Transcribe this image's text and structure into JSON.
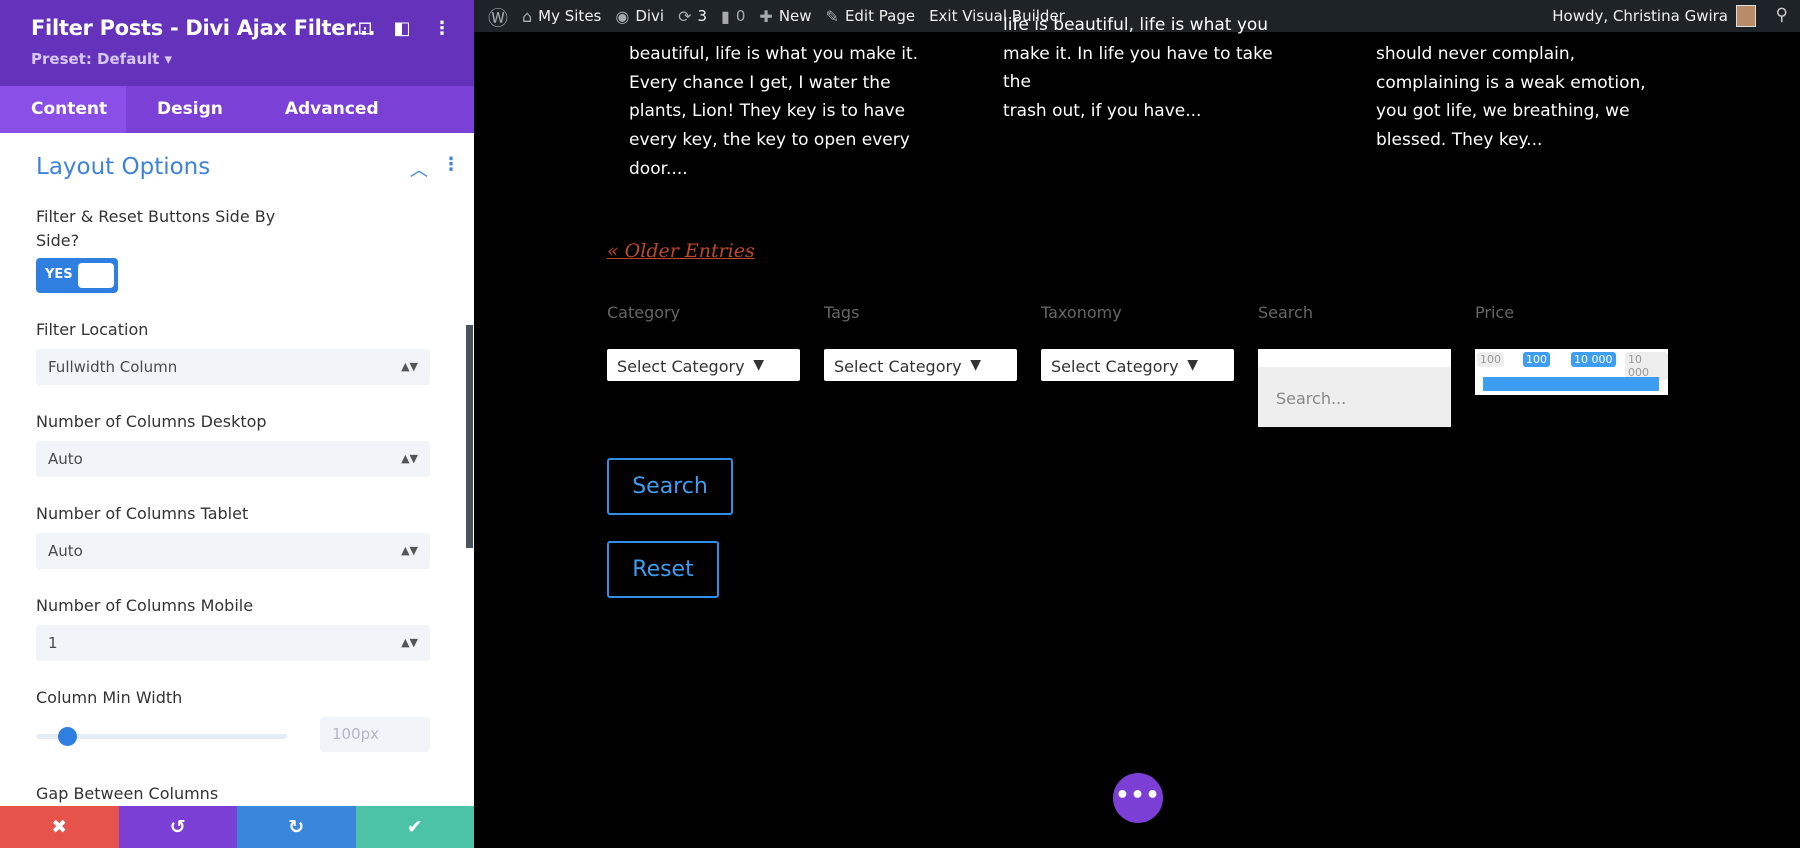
{
  "panel": {
    "title": "Filter Posts - Divi Ajax Filter...",
    "preset": "Preset: Default ▾",
    "tabs": [
      "Content",
      "Design",
      "Advanced"
    ],
    "section_title": "Layout Options",
    "fields": {
      "side_by_side_label": "Filter & Reset Buttons Side By Side?",
      "side_by_side_value": "YES",
      "filter_location_label": "Filter Location",
      "filter_location_value": "Fullwidth Column",
      "cols_desktop_label": "Number of Columns Desktop",
      "cols_desktop_value": "Auto",
      "cols_tablet_label": "Number of Columns Tablet",
      "cols_tablet_value": "Auto",
      "cols_mobile_label": "Number of Columns Mobile",
      "cols_mobile_value": "1",
      "min_width_label": "Column Min Width",
      "min_width_value": "100px",
      "gap_label": "Gap Between Columns"
    },
    "bottom": {
      "cancel": "✖",
      "undo": "↺",
      "redo": "↻",
      "save": "✔"
    },
    "colors": {
      "header": "#6532bb",
      "tabs": "#7b40d6",
      "accent": "#3e83d9",
      "cancel": "#e5534b",
      "undo": "#7b3fd6",
      "redo": "#3b86dd",
      "save": "#4cc3a6"
    }
  },
  "adminbar": {
    "my_sites": "My Sites",
    "site": "Divi",
    "updates": "3",
    "comments": "0",
    "new": "New",
    "edit": "Edit Page",
    "exit": "Exit Visual Builder",
    "howdy": "Howdy, Christina Gwira"
  },
  "posts": [
    [
      "beautiful, life is what you make it.",
      "Every chance I get, I water the",
      "plants, Lion! They key is to have",
      "every key, the key to open every",
      "door...."
    ],
    [
      "life is beautiful, life is what you",
      "make it. In life you have to take the",
      "trash out, if you have..."
    ],
    [
      "should never complain,",
      "complaining is a weak emotion,",
      "you got life, we breathing, we",
      "blessed. They key..."
    ]
  ],
  "older_entries": "« Older Entries",
  "filters": {
    "labels": [
      "Category",
      "Tags",
      "Taxonomy",
      "Search",
      "Price"
    ],
    "select_value": "Select Category",
    "search_placeholder": "Search...",
    "price": {
      "min": "100",
      "from": "100",
      "to": "10 000",
      "max": "10 000"
    }
  },
  "buttons": {
    "search": "Search",
    "reset": "Reset"
  },
  "fab": "•••"
}
